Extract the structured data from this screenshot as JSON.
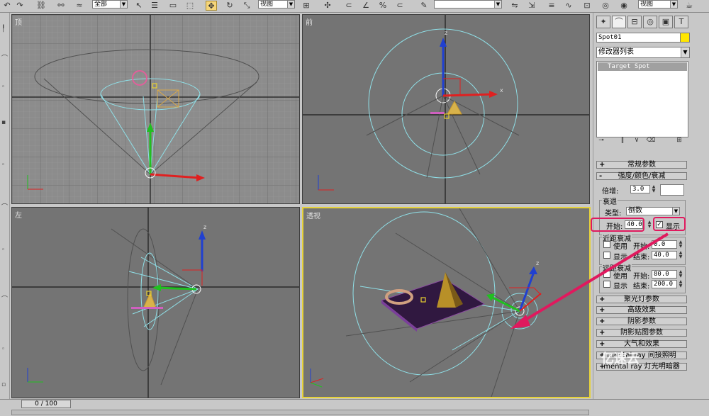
{
  "toolbar": {
    "selection_filter": "全部",
    "ref_coord": "视图",
    "ref_coord_right": "视图"
  },
  "viewports": {
    "top": "顶",
    "front": "前",
    "left": "左",
    "perspective": "透视"
  },
  "axes": {
    "x": "x",
    "y": "y",
    "z": "z"
  },
  "command_panel": {
    "object_name": "Spot01",
    "object_color": "#ffe600",
    "modifier_list": "修改器列表",
    "stack_item": "Target Spot",
    "rollouts": {
      "general": "常规参数",
      "intensity": "强度/颜色/衰减",
      "spotlight": "聚光灯参数",
      "advanced": "高级效果",
      "shadow": "阴影参数",
      "shadow_map": "阴影贴图参数",
      "atmosphere": "大气和效果",
      "mental_ray": "mental ray 间接照明",
      "mental_ray_2": "mental ray 灯光明暗器"
    },
    "multiplier_label": "倍增:",
    "multiplier_value": "3.0",
    "decay": {
      "title": "衰退",
      "type_label": "类型:",
      "type_value": "倒数",
      "start_label": "开始:",
      "start_value": "40.0",
      "show_label": "显示",
      "show_checked": true
    },
    "near_atten": {
      "title": "近距衰减",
      "use": "使用",
      "show": "显示",
      "start_label": "开始:",
      "start_value": "0.0",
      "end_label": "结束:",
      "end_value": "40.0"
    },
    "far_atten": {
      "title": "远距衰减",
      "use": "使用",
      "show": "显示",
      "start_label": "开始:",
      "start_value": "80.0",
      "end_label": "结束:",
      "end_value": "200.0"
    }
  },
  "timeline": {
    "frame": "0 / 100"
  },
  "highlight_color": "#e0195e",
  "watermark": "亿速云"
}
